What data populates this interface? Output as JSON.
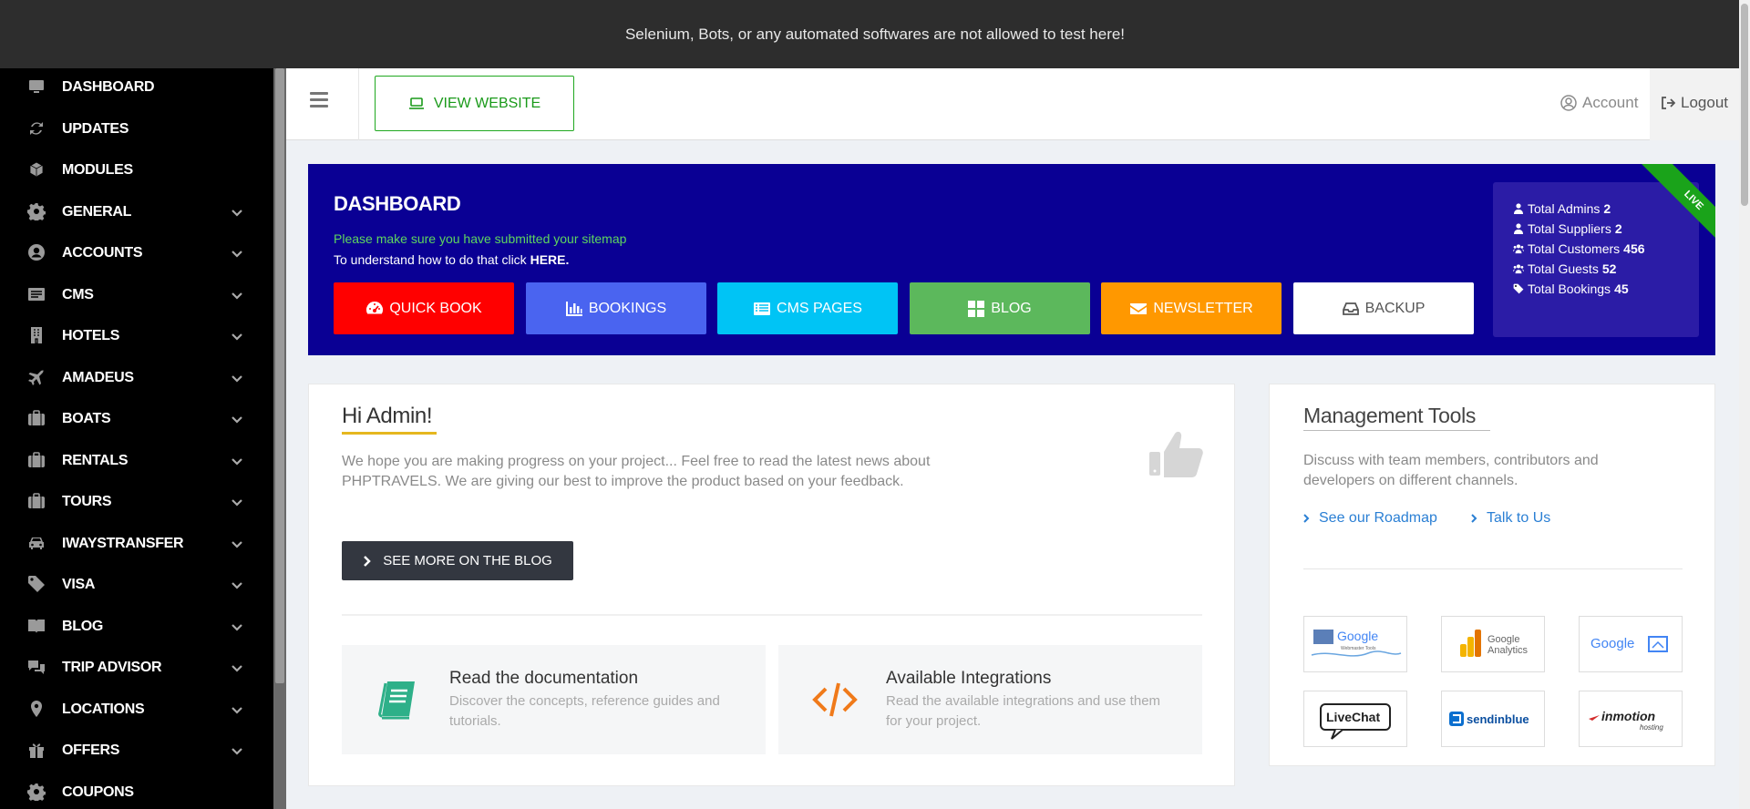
{
  "notice": {
    "text": "Selenium, Bots, or any automated softwares are not allowed to test here!"
  },
  "sidebar": {
    "items": [
      {
        "label": "DASHBOARD",
        "icon": "monitor-icon",
        "expandable": false
      },
      {
        "label": "UPDATES",
        "icon": "refresh-icon",
        "expandable": false
      },
      {
        "label": "MODULES",
        "icon": "cube-icon",
        "expandable": false
      },
      {
        "label": "GENERAL",
        "icon": "gear-icon",
        "expandable": true
      },
      {
        "label": "ACCOUNTS",
        "icon": "user-circle-icon",
        "expandable": true
      },
      {
        "label": "CMS",
        "icon": "cms-icon",
        "expandable": true
      },
      {
        "label": "HOTELS",
        "icon": "building-icon",
        "expandable": true
      },
      {
        "label": "AMADEUS",
        "icon": "plane-icon",
        "expandable": true
      },
      {
        "label": "BOATS",
        "icon": "briefcase-icon",
        "expandable": true
      },
      {
        "label": "RENTALS",
        "icon": "briefcase-icon",
        "expandable": true
      },
      {
        "label": "TOURS",
        "icon": "briefcase-icon",
        "expandable": true
      },
      {
        "label": "IWAYSTRANSFER",
        "icon": "car-icon",
        "expandable": true
      },
      {
        "label": "VISA",
        "icon": "tag-icon",
        "expandable": true
      },
      {
        "label": "BLOG",
        "icon": "book-icon",
        "expandable": true
      },
      {
        "label": "TRIP ADVISOR",
        "icon": "chat-icon",
        "expandable": true
      },
      {
        "label": "LOCATIONS",
        "icon": "map-pin-icon",
        "expandable": true
      },
      {
        "label": "OFFERS",
        "icon": "gift-icon",
        "expandable": true
      },
      {
        "label": "COUPONS",
        "icon": "gear-icon",
        "expandable": false
      }
    ]
  },
  "header": {
    "view_website": "VIEW WEBSITE",
    "account": "Account",
    "logout": "Logout"
  },
  "banner": {
    "title": "DASHBOARD",
    "note_sitemap": "Please make sure you have submitted your sitemap",
    "note_howto": "To understand how to do that click",
    "note_link": "HERE.",
    "ribbon": "LIVE",
    "buttons": [
      {
        "label": "QUICK BOOK",
        "color": "#ff0000",
        "icon": "dashboard-gauge-icon"
      },
      {
        "label": "BOOKINGS",
        "color": "#4a64f0",
        "icon": "bar-chart-icon"
      },
      {
        "label": "CMS PAGES",
        "color": "#00c4f5",
        "icon": "list-icon"
      },
      {
        "label": "BLOG",
        "color": "#5cb85c",
        "icon": "grid-icon"
      },
      {
        "label": "NEWSLETTER",
        "color": "#ff9800",
        "icon": "envelope-icon"
      },
      {
        "label": "BACKUP",
        "color": "#ffffff",
        "icon": "inbox-icon"
      }
    ],
    "stats": [
      {
        "label": "Total Admins",
        "value": "2",
        "icon": "user-icon"
      },
      {
        "label": "Total Suppliers",
        "value": "2",
        "icon": "user-icon"
      },
      {
        "label": "Total Customers",
        "value": "456",
        "icon": "users-icon"
      },
      {
        "label": "Total Guests",
        "value": "52",
        "icon": "users-icon"
      },
      {
        "label": "Total Bookings",
        "value": "45",
        "icon": "tag-icon"
      }
    ]
  },
  "welcome": {
    "greeting": "Hi Admin!",
    "text": "We hope you are making progress on your project... Feel free to read the latest news about PHPTRAVELS. We are giving our best to improve the product based on your feedback.",
    "blog_button": "SEE MORE ON THE BLOG",
    "features": [
      {
        "title": "Read the documentation",
        "desc": "Discover the concepts, reference guides and tutorials.",
        "icon": "book-icon"
      },
      {
        "title": "Available Integrations",
        "desc": "Read the available integrations and use them for your project.",
        "icon": "code-icon"
      }
    ]
  },
  "tools": {
    "title": "Management Tools",
    "desc": "Discuss with team members, contributors and developers on different channels.",
    "links": [
      "See our Roadmap",
      "Talk to Us"
    ],
    "logos": [
      {
        "name": "Google",
        "sub": "Webmaster Tools"
      },
      {
        "name": "Google",
        "sub": "Analytics"
      },
      {
        "name": "Google"
      },
      {
        "name": "LiveChat"
      },
      {
        "name": "sendinblue"
      },
      {
        "name": "inmotion",
        "sub": "hosting"
      }
    ]
  }
}
